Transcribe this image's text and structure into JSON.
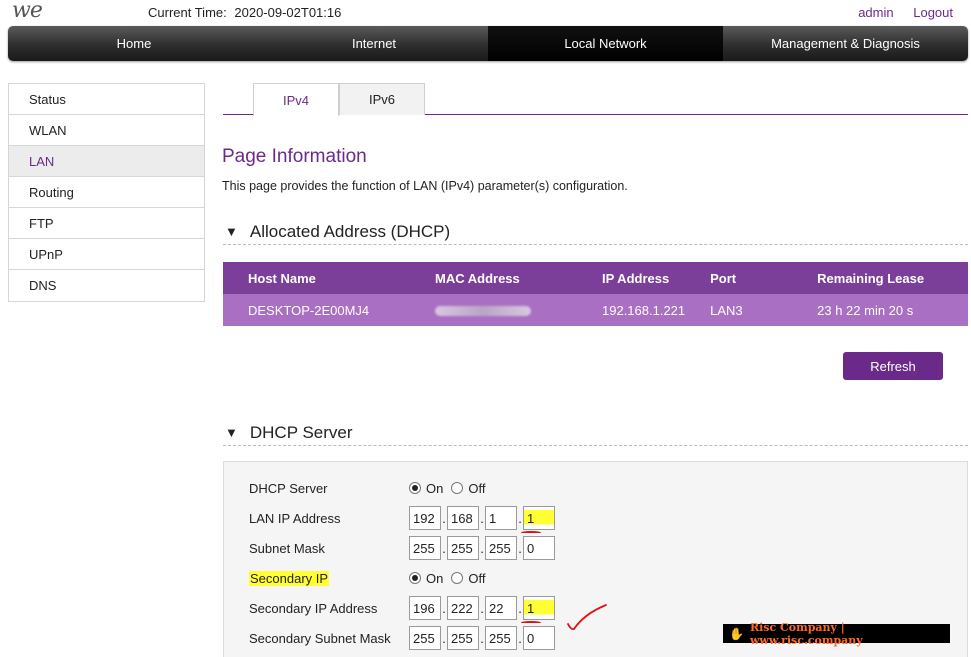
{
  "header": {
    "logo": "we",
    "current_time_label": "Current Time:",
    "current_time_value": "2020-09-02T01:16",
    "user": "admin",
    "logout": "Logout"
  },
  "nav": {
    "items": [
      {
        "label": "Home"
      },
      {
        "label": "Internet"
      },
      {
        "label": "Local Network"
      },
      {
        "label": "Management & Diagnosis"
      }
    ],
    "active": "Local Network"
  },
  "sidebar": {
    "items": [
      {
        "label": "Status"
      },
      {
        "label": "WLAN"
      },
      {
        "label": "LAN"
      },
      {
        "label": "Routing"
      },
      {
        "label": "FTP"
      },
      {
        "label": "UPnP"
      },
      {
        "label": "DNS"
      }
    ],
    "active": "LAN"
  },
  "tabs": [
    {
      "label": "IPv4"
    },
    {
      "label": "IPv6"
    }
  ],
  "page": {
    "title": "Page Information",
    "description": "This page provides the function of LAN (IPv4) parameter(s) configuration."
  },
  "allocated": {
    "section_title": "Allocated Address (DHCP)",
    "columns": [
      "Host Name",
      "MAC Address",
      "IP Address",
      "Port",
      "Remaining Lease"
    ],
    "rows": [
      {
        "host": "DESKTOP-2E00MJ4",
        "mac": "",
        "ip": "192.168.1.221",
        "port": "LAN3",
        "lease": "23 h 22 min 20 s"
      }
    ],
    "refresh_label": "Refresh"
  },
  "dhcp_server": {
    "section_title": "DHCP Server",
    "dhcp_server_label": "DHCP Server",
    "dhcp_on_label": "On",
    "dhcp_off_label": "Off",
    "lan_ip_label": "LAN IP Address",
    "lan_ip": [
      "192",
      "168",
      "1",
      "1"
    ],
    "subnet_label": "Subnet Mask",
    "subnet": [
      "255",
      "255",
      "255",
      "0"
    ],
    "secondary_ip_label": "Secondary IP",
    "secondary_on_label": "On",
    "secondary_off_label": "Off",
    "secondary_addr_label": "Secondary IP Address",
    "secondary_addr": [
      "196",
      "222",
      "22",
      "1"
    ],
    "secondary_mask_label": "Secondary Subnet Mask",
    "secondary_mask": [
      "255",
      "255",
      "255",
      "0"
    ]
  },
  "watermark": {
    "text": "Risc Company | www.risc.company"
  },
  "colors": {
    "accent": "#6b2a8a",
    "table_header": "#7b3f99",
    "table_row": "#a96fc2",
    "highlight": "#ffff33",
    "annotation": "#e01010"
  }
}
